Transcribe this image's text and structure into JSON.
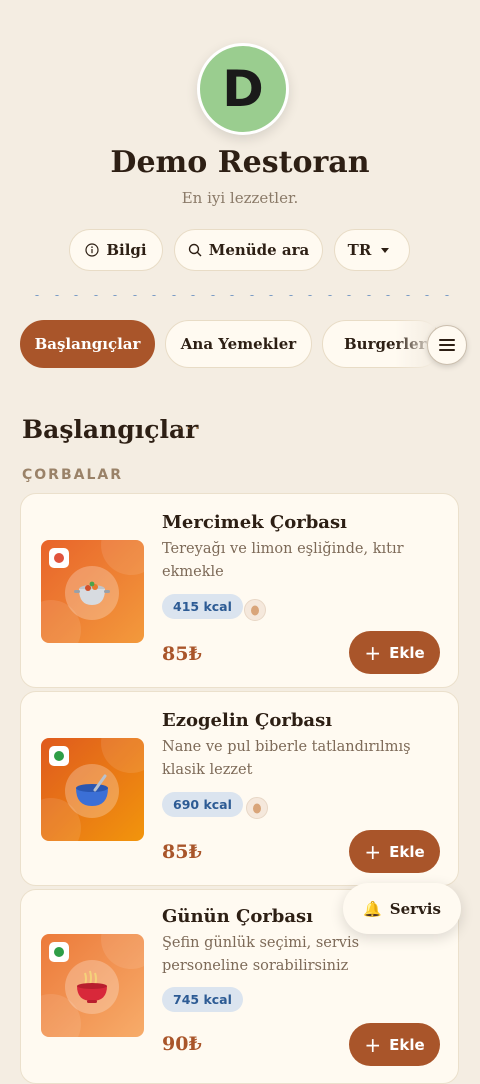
{
  "restaurant": {
    "logo_letter": "D",
    "name": "Demo Restoran",
    "tagline": "En iyi lezzetler."
  },
  "actions": {
    "info_label": "Bilgi",
    "search_label": "Menüde ara",
    "language_label": "TR"
  },
  "tabs": [
    {
      "label": "Başlangıçlar",
      "active": true
    },
    {
      "label": "Ana Yemekler",
      "active": false
    },
    {
      "label": "Burgerler",
      "active": false
    }
  ],
  "section": {
    "title": "Başlangıçlar",
    "subsection": "ÇORBALAR"
  },
  "items": [
    {
      "name": "Mercimek Çorbası",
      "description": "Tereyağı ve limon eşliğinde, kıtır ekmekle",
      "kcal": "415 kcal",
      "price": "85₺",
      "add_label": "Ekle",
      "icon": "pot-icon",
      "dot_color": "#e0533d"
    },
    {
      "name": "Ezogelin Çorbası",
      "description": "Nane ve pul biberle tatlandırılmış klasik lezzet",
      "kcal": "690 kcal",
      "price": "85₺",
      "add_label": "Ekle",
      "icon": "bowl-icon",
      "dot_color": "#2e9e47"
    },
    {
      "name": "Günün Çorbası",
      "description": "Şefin günlük seçimi, servis personeline sorabilirsiniz",
      "kcal": "745 kcal",
      "price": "90₺",
      "add_label": "Ekle",
      "icon": "noodle-bowl-icon",
      "dot_color": "#2e9e47"
    }
  ],
  "floating": {
    "service_label": "Servis"
  },
  "colors": {
    "accent": "#a9552a",
    "background": "#f4ede2",
    "kcal_badge": "#dbe4ef"
  }
}
